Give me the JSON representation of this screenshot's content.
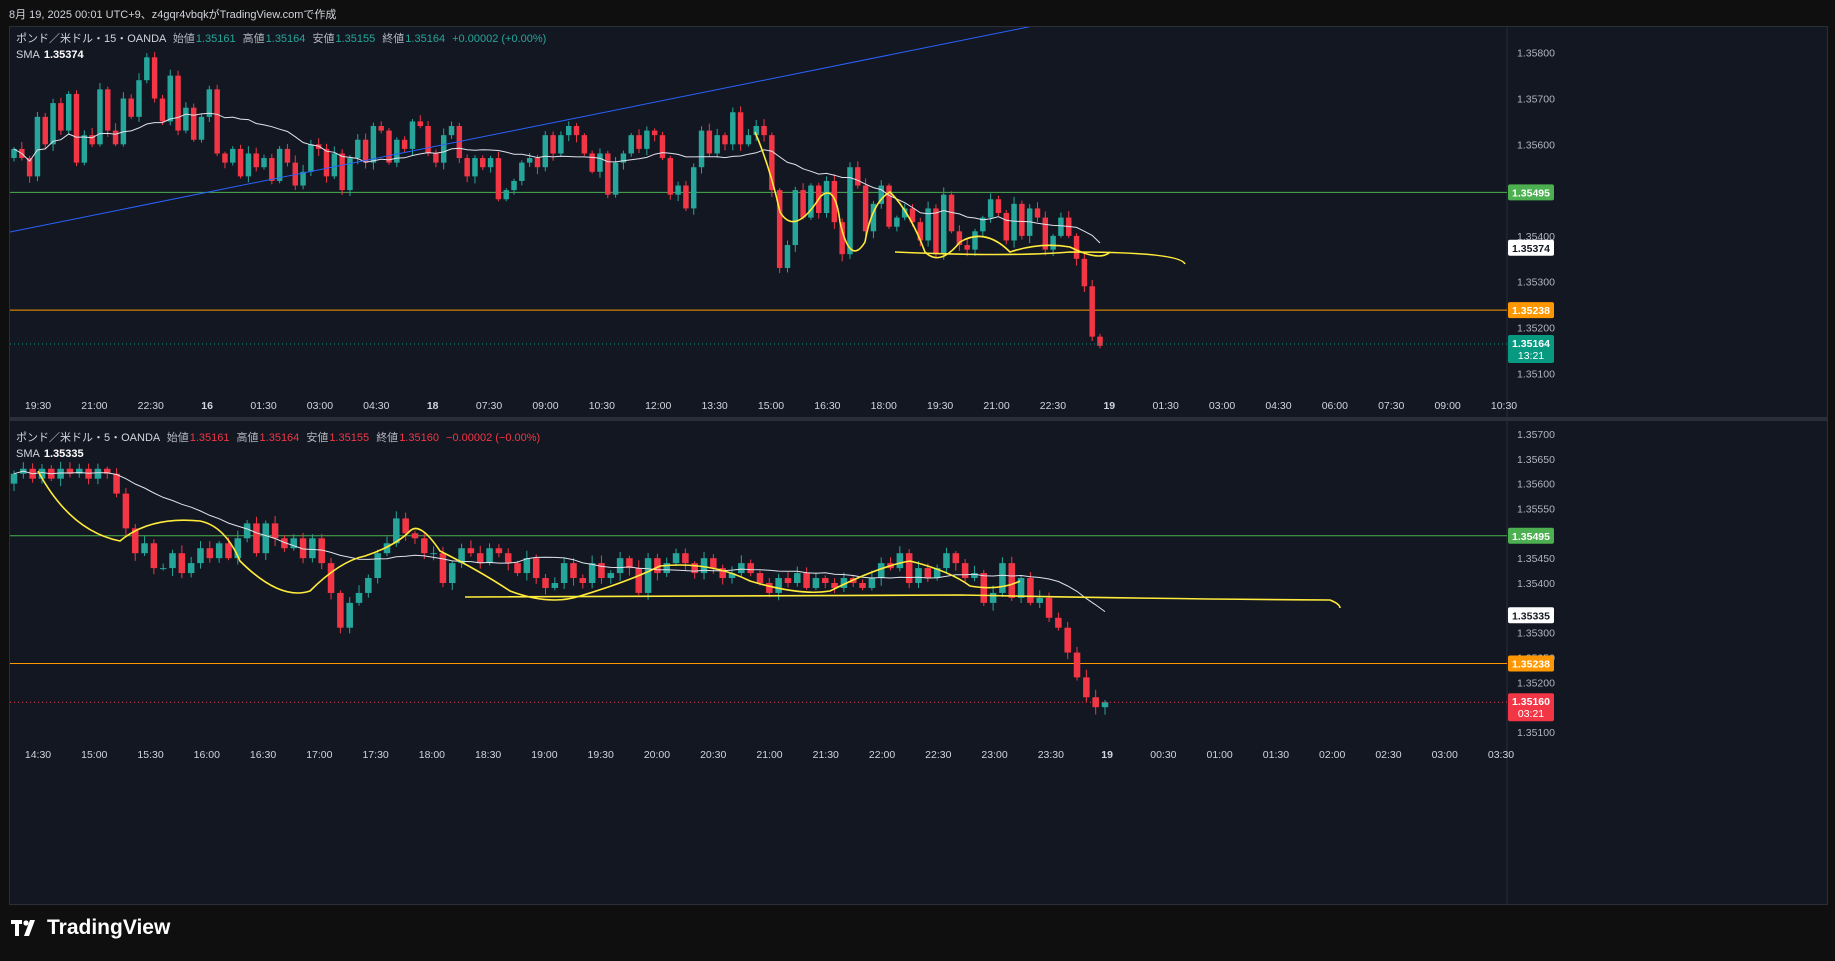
{
  "header_text": "8月 19, 2025 00:01 UTC+9、z4gqr4vbqkがTradingView.comで作成",
  "brand": {
    "name": "TradingView",
    "logo_icon": "tradingview-logo-icon"
  },
  "colors": {
    "up": "#26a69a",
    "down": "#f23645",
    "sma": "#e0e3eb",
    "trend": "#2962ff",
    "resistance": "#4caf50",
    "support": "#ff9800",
    "yellow": "#ffeb3b",
    "bg": "#131722"
  },
  "chart_data": [
    {
      "type": "candlestick",
      "symbol": "ポンド／米ドル・15・OANDA",
      "ohlc": {
        "open_label": "始値",
        "open": "1.35161",
        "high_label": "高値",
        "high": "1.35164",
        "low_label": "安値",
        "low": "1.35155",
        "close_label": "終値",
        "close": "1.35164",
        "change": "+0.00002 (+0.00%)"
      },
      "sma_label": "SMA",
      "sma_value": "1.35374",
      "y_ticks": [
        "1.35800",
        "1.35700",
        "1.35600",
        "1.35400",
        "1.35300",
        "1.35200",
        "1.35100"
      ],
      "ylim": [
        1.3507,
        1.3583
      ],
      "x_ticks": [
        "19:30",
        "21:00",
        "22:30",
        "16",
        "01:30",
        "03:00",
        "04:30",
        "18",
        "07:30",
        "09:00",
        "10:30",
        "12:00",
        "13:30",
        "15:00",
        "16:30",
        "18:00",
        "19:30",
        "21:00",
        "22:30",
        "19",
        "01:30",
        "03:00",
        "04:30",
        "06:00",
        "07:30",
        "09:00",
        "10:30"
      ],
      "levels": [
        {
          "value": 1.35495,
          "label": "1.35495",
          "color": "#4caf50"
        },
        {
          "value": 1.35238,
          "label": "1.35238",
          "color": "#ff9800"
        }
      ],
      "sma_tag": "1.35374",
      "price_tag": {
        "value": 1.35164,
        "label": "1.35164",
        "countdown": "13:21",
        "color": "#089981"
      },
      "candles_close": [
        1.3559,
        1.3557,
        1.3553,
        1.3566,
        1.356,
        1.3569,
        1.3563,
        1.3571,
        1.3556,
        1.3562,
        1.356,
        1.3572,
        1.3563,
        1.356,
        1.357,
        1.3566,
        1.3574,
        1.3579,
        1.357,
        1.3565,
        1.3575,
        1.3563,
        1.3568,
        1.3561,
        1.3566,
        1.3572,
        1.3558,
        1.3556,
        1.3559,
        1.3553,
        1.3558,
        1.3555,
        1.3557,
        1.3552,
        1.3559,
        1.3556,
        1.3551,
        1.3554,
        1.356,
        1.3559,
        1.3553,
        1.3558,
        1.355,
        1.3557,
        1.3561,
        1.3556,
        1.3564,
        1.3563,
        1.3556,
        1.3561,
        1.3559,
        1.3565,
        1.3564,
        1.3558,
        1.3556,
        1.3562,
        1.3564,
        1.3557,
        1.3553,
        1.3557,
        1.3555,
        1.3557,
        1.3548,
        1.355,
        1.3552,
        1.3556,
        1.3557,
        1.3555,
        1.3562,
        1.3558,
        1.3562,
        1.3564,
        1.3562,
        1.3558,
        1.3554,
        1.3558,
        1.3549,
        1.3556,
        1.3558,
        1.3562,
        1.3559,
        1.3563,
        1.3562,
        1.3557,
        1.3549,
        1.3551,
        1.3546,
        1.3555,
        1.3563,
        1.3558,
        1.3562,
        1.356,
        1.3567,
        1.356,
        1.3562,
        1.3564,
        1.3562,
        1.355,
        1.3533,
        1.3538,
        1.355,
        1.3544,
        1.3551,
        1.3545,
        1.3552,
        1.3543,
        1.3536,
        1.3555,
        1.3551,
        1.3541,
        1.3547,
        1.3551,
        1.3542,
        1.3544,
        1.3546,
        1.3543,
        1.3539,
        1.3546,
        1.3536,
        1.3549,
        1.3541,
        1.3538,
        1.3537,
        1.3541,
        1.3544,
        1.3548,
        1.3545,
        1.3539,
        1.3547,
        1.354,
        1.3546,
        1.3544,
        1.3537,
        1.354,
        1.3544,
        1.354,
        1.3535,
        1.3529,
        1.3518,
        1.3516
      ]
    },
    {
      "type": "candlestick",
      "symbol": "ポンド／米ドル・5・OANDA",
      "ohlc": {
        "open_label": "始値",
        "open": "1.35161",
        "high_label": "高値",
        "high": "1.35164",
        "low_label": "安値",
        "low": "1.35155",
        "close_label": "終値",
        "close": "1.35160",
        "change": "−0.00002 (−0.00%)"
      },
      "sma_label": "SMA",
      "sma_value": "1.35335",
      "y_ticks": [
        "1.35700",
        "1.35650",
        "1.35600",
        "1.35550",
        "1.35450",
        "1.35400",
        "1.35300",
        "1.35250",
        "1.35200",
        "1.35100"
      ],
      "ylim": [
        1.3509,
        1.3571
      ],
      "x_ticks": [
        "14:30",
        "15:00",
        "15:30",
        "16:00",
        "16:30",
        "17:00",
        "17:30",
        "18:00",
        "18:30",
        "19:00",
        "19:30",
        "20:00",
        "20:30",
        "21:00",
        "21:30",
        "22:00",
        "22:30",
        "23:00",
        "23:30",
        "19",
        "00:30",
        "01:00",
        "01:30",
        "02:00",
        "02:30",
        "03:00",
        "03:30"
      ],
      "levels": [
        {
          "value": 1.35495,
          "label": "1.35495",
          "color": "#4caf50"
        },
        {
          "value": 1.35238,
          "label": "1.35238",
          "color": "#ff9800"
        }
      ],
      "sma_tag": "1.35335",
      "price_tag": {
        "value": 1.3516,
        "label": "1.35160",
        "countdown": "03:21",
        "color": "#f23645"
      },
      "candles_close": [
        1.3562,
        1.3563,
        1.3561,
        1.3563,
        1.3561,
        1.3563,
        1.3562,
        1.3563,
        1.3561,
        1.3563,
        1.3562,
        1.3558,
        1.3551,
        1.3546,
        1.3548,
        1.3543,
        1.3543,
        1.3546,
        1.3542,
        1.3544,
        1.3547,
        1.3545,
        1.3548,
        1.3545,
        1.3549,
        1.3552,
        1.3546,
        1.3552,
        1.3549,
        1.3547,
        1.3549,
        1.3545,
        1.3549,
        1.3544,
        1.3538,
        1.3531,
        1.3536,
        1.3538,
        1.3541,
        1.3546,
        1.3548,
        1.3553,
        1.355,
        1.3549,
        1.3546,
        1.3546,
        1.354,
        1.3544,
        1.3547,
        1.3546,
        1.3544,
        1.3547,
        1.3546,
        1.3544,
        1.3542,
        1.3545,
        1.3541,
        1.3539,
        1.354,
        1.3544,
        1.3541,
        1.354,
        1.3544,
        1.3541,
        1.3542,
        1.3545,
        1.3543,
        1.3538,
        1.3545,
        1.3542,
        1.3544,
        1.3546,
        1.3544,
        1.3542,
        1.3545,
        1.3543,
        1.3541,
        1.3542,
        1.3544,
        1.3542,
        1.354,
        1.3538,
        1.3541,
        1.354,
        1.3542,
        1.3539,
        1.3541,
        1.354,
        1.3539,
        1.3541,
        1.354,
        1.3539,
        1.3541,
        1.3544,
        1.3543,
        1.3546,
        1.354,
        1.3543,
        1.3541,
        1.3543,
        1.3546,
        1.3544,
        1.3541,
        1.3542,
        1.3536,
        1.3538,
        1.3544,
        1.3537,
        1.3541,
        1.3536,
        1.3537,
        1.3533,
        1.3531,
        1.3526,
        1.3521,
        1.3517,
        1.3515,
        1.3516
      ]
    }
  ]
}
